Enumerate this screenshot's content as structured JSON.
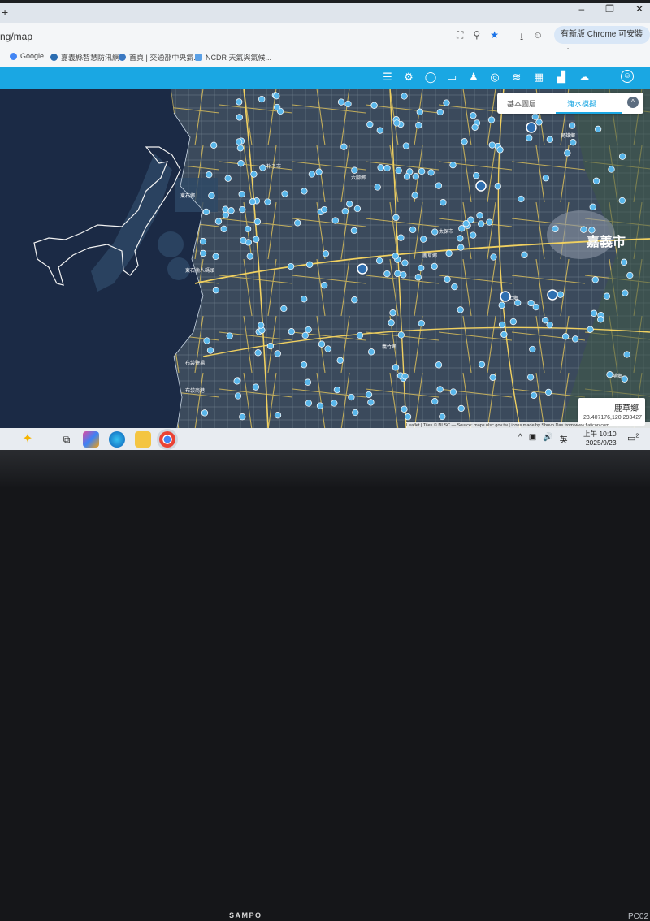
{
  "browser": {
    "new_tab_symbol": "+",
    "window_controls": [
      "–",
      "❐",
      "✕"
    ],
    "url": "ng/map",
    "update_button_label": "有新版 Chrome 可安裝",
    "menu_symbol": "⋮",
    "address_icons": [
      "translate-icon",
      "zoom-icon",
      "star-icon",
      "download-icon",
      "profile-icon"
    ],
    "bookmarks": [
      {
        "label": "Google",
        "color": "#4285f4"
      },
      {
        "label": "嘉義縣智慧防汛網",
        "color": "#2b6cb0"
      },
      {
        "label": "首頁 | 交通部中央氣...",
        "color": "#3a78c2"
      },
      {
        "label": "NCDR 天氣與氣候...",
        "color": "#5aa0e6"
      }
    ]
  },
  "app_toolbar": {
    "color": "#1aa7e3",
    "icons": [
      "layers-icon",
      "satellite-icon",
      "rain-drop-icon",
      "cctv-icon",
      "pump-station-icon",
      "gate-icon",
      "people-icon",
      "water-level-icon",
      "map-icon",
      "tide-icon",
      "report-icon",
      "chart-icon",
      "weather-icon",
      "user-icon"
    ]
  },
  "map": {
    "layer_tabs": [
      "基本圖層",
      "淹水模擬"
    ],
    "active_tab": "淹水模擬",
    "collapse_symbol": "^",
    "city_label": "嘉義市",
    "place_labels": [
      "東石鄉",
      "東石漁人碼頭",
      "布袋鹽場",
      "布袋商港",
      "朴子市",
      "六腳鄉",
      "太保市",
      "鹿草鄉",
      "水上鄉",
      "義竹鄉",
      "中埔鄉",
      "民雄鄉"
    ],
    "location_name": "鹿草鄉",
    "location_coords": "23.407176,120.293427",
    "attribution": "Leaflet | Tiles © NLSC — Source: maps.nlsc.gov.tw | icons made by Shuvo Das from www.flaticon.com"
  },
  "taskbar": {
    "apps": [
      "copilot-icon",
      "task-view-icon",
      "widgets-icon",
      "edge-icon",
      "file-explorer-icon",
      "chrome-icon"
    ],
    "tray_symbols": [
      "^",
      "▣",
      "🔊",
      "英"
    ],
    "time": "上午 10:10",
    "date": "2025/9/23",
    "notification_count": "2"
  },
  "monitor": {
    "brand": "SAMPO",
    "corner_label": "PC02"
  }
}
